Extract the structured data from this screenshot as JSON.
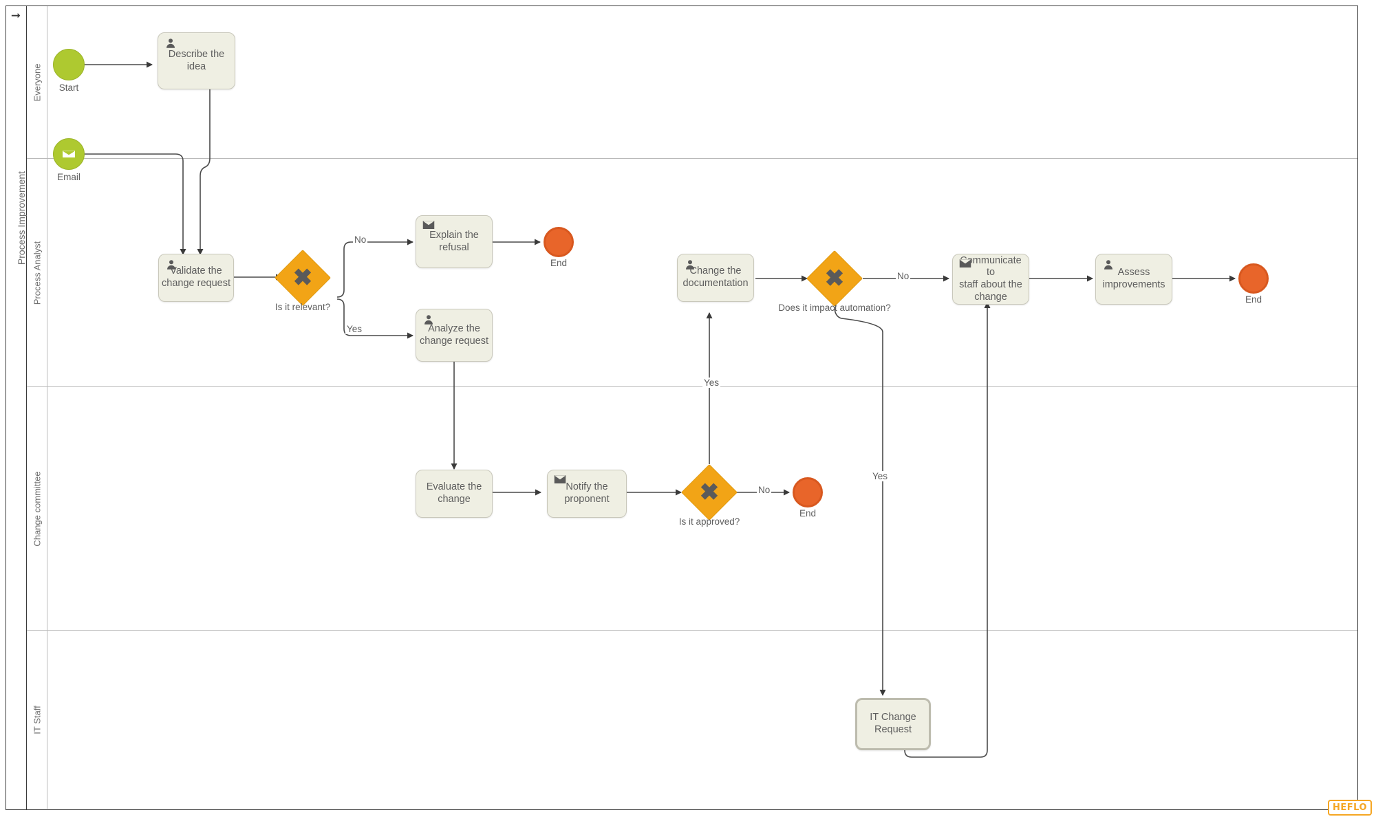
{
  "pool": {
    "name": "Process Improvement",
    "arrow_icon": "arrow-right-icon"
  },
  "lanes": [
    {
      "id": "everyone",
      "label": "Everyone"
    },
    {
      "id": "process-analyst",
      "label": "Process Analyst"
    },
    {
      "id": "change-committee",
      "label": "Change committee"
    },
    {
      "id": "it-staff",
      "label": "IT Staff"
    }
  ],
  "nodes": {
    "start": {
      "label": "Start",
      "type": "start-event",
      "icon": "none"
    },
    "email": {
      "label": "Email",
      "type": "start-event",
      "icon": "envelope-icon"
    },
    "describe_idea": {
      "label": "Describe the idea",
      "type": "user-task",
      "icon": "user-icon"
    },
    "validate_request": {
      "label": "Validate the\nchange request",
      "type": "user-task",
      "icon": "user-icon"
    },
    "gw_relevant": {
      "label": "Is it relevant?",
      "type": "exclusive-gateway"
    },
    "explain_refusal": {
      "label": "Explain the refusal",
      "type": "send-task",
      "icon": "envelope-icon"
    },
    "end_refusal": {
      "label": "End",
      "type": "end-event"
    },
    "analyze_request": {
      "label": "Analyze the\nchange request",
      "type": "user-task",
      "icon": "user-icon"
    },
    "evaluate_change": {
      "label": "Evaluate the\nchange",
      "type": "task",
      "icon": "none"
    },
    "notify_proponent": {
      "label": "Notify the\nproponent",
      "type": "send-task",
      "icon": "envelope-icon"
    },
    "gw_approved": {
      "label": "Is it approved?",
      "type": "exclusive-gateway"
    },
    "end_not_approved": {
      "label": "End",
      "type": "end-event"
    },
    "change_documentation": {
      "label": "Change the\ndocumentation",
      "type": "user-task",
      "icon": "user-icon"
    },
    "gw_automation": {
      "label": "Does it impact automation?",
      "type": "exclusive-gateway"
    },
    "it_change_request": {
      "label": "IT Change\nRequest",
      "type": "call-activity",
      "icon": "none"
    },
    "communicate_staff": {
      "label": "Communicate to\nstaff about the\nchange",
      "type": "send-task",
      "icon": "envelope-icon"
    },
    "assess_improvements": {
      "label": "Assess\nimprovements",
      "type": "user-task",
      "icon": "user-icon"
    },
    "end_final": {
      "label": "End",
      "type": "end-event"
    }
  },
  "edge_labels": {
    "relevant_no": "No",
    "relevant_yes": "Yes",
    "approved_no": "No",
    "approved_yes": "Yes",
    "automation_no": "No",
    "automation_yes": "Yes"
  },
  "watermark": {
    "text": "HEFLO"
  },
  "colors": {
    "start_green": "#aec930",
    "end_orange": "#e8652a",
    "gateway_orange": "#f2a416",
    "task_fill": "#efefe3",
    "task_border": "#c9c8bb",
    "text_gray": "#5e5e5e",
    "lane_border": "#b9b9b9",
    "pool_border": "#3a3a3a",
    "heflo_orange": "#f5a623"
  }
}
